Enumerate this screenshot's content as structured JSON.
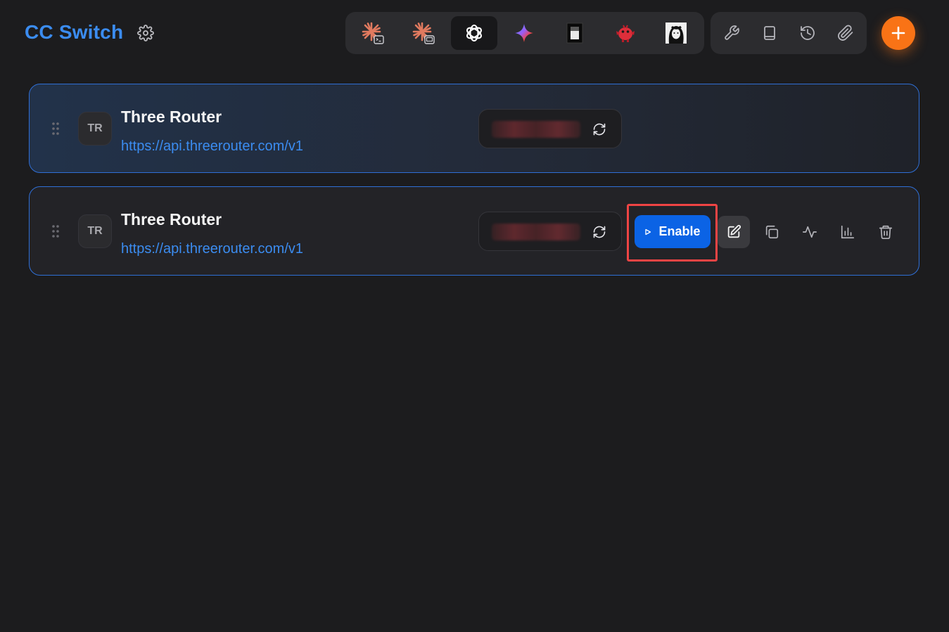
{
  "header": {
    "title": "CC Switch",
    "settings_icon": "gear-icon"
  },
  "app_tabs": [
    {
      "name": "claude-code-icon",
      "active": false
    },
    {
      "name": "claude-desktop-icon",
      "active": false
    },
    {
      "name": "openai-codex-icon",
      "active": true
    },
    {
      "name": "gemini-icon",
      "active": false
    },
    {
      "name": "opencode-icon",
      "active": false
    },
    {
      "name": "red-bot-icon",
      "active": false
    },
    {
      "name": "avatar-app-icon",
      "active": false
    }
  ],
  "tools": [
    "wrench-icon",
    "book-icon",
    "history-icon",
    "paperclip-icon"
  ],
  "add_button_icon": "plus-icon",
  "providers": [
    {
      "avatar": "TR",
      "name": "Three Router",
      "url": "https://api.threerouter.com/v1",
      "state": "active"
    },
    {
      "avatar": "TR",
      "name": "Three Router",
      "url": "https://api.threerouter.com/v1",
      "state": "inactive",
      "enable_label": "Enable"
    }
  ],
  "colors": {
    "accent": "#3b8cf0",
    "enable": "#0b63e5",
    "add": "#f97316",
    "highlight": "#ef4444"
  }
}
